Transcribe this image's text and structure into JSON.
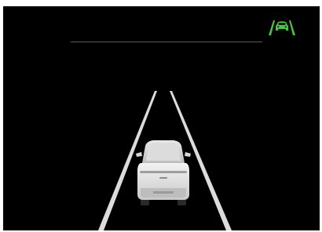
{
  "screen": {
    "background": "#000000",
    "state": "lane-keeping-assist-active"
  },
  "indicator": {
    "icon": "lane-keeping-assist-icon",
    "color": "#4cc24a"
  },
  "lanes": {
    "color": "#d9d9d9",
    "count": 2
  },
  "vehicle": {
    "icon": "ego-vehicle-rear-view",
    "color": "#e6e6e6"
  }
}
